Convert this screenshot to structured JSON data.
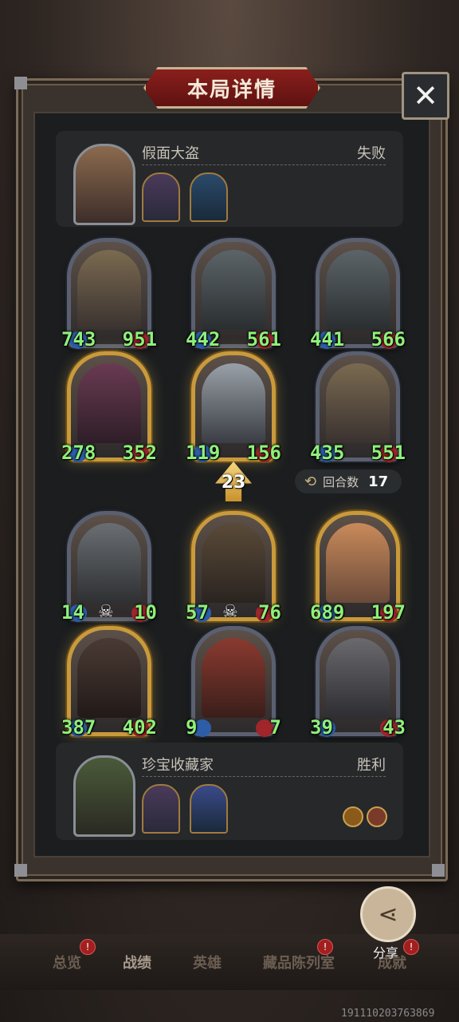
{
  "title": "本局详情",
  "close_icon": "close-icon",
  "top_player": {
    "name": "假面大盗",
    "result": "失败",
    "cards": [
      {
        "atk": "743",
        "hp": "951",
        "style": "silver",
        "art": "#7a6a50"
      },
      {
        "atk": "442",
        "hp": "561",
        "style": "silver",
        "art": "#5c6468"
      },
      {
        "atk": "441",
        "hp": "566",
        "style": "silver",
        "art": "#5c6468"
      },
      {
        "atk": "278",
        "hp": "352",
        "style": "gold",
        "art": "#6a3a52"
      },
      {
        "atk": "119",
        "hp": "156",
        "style": "gold",
        "art": "#7f858c"
      },
      {
        "atk": "435",
        "hp": "551",
        "style": "silver",
        "art": "#7a6a50"
      }
    ]
  },
  "tier_level": "23",
  "rounds": {
    "label": "回合数",
    "value": "17"
  },
  "bottom_player": {
    "name": "珍宝收藏家",
    "result": "胜利",
    "cards": [
      {
        "atk": "14",
        "hp": "10",
        "style": "silver",
        "art": "#6a6e72",
        "dead": true
      },
      {
        "atk": "57",
        "hp": "76",
        "style": "gold",
        "art": "#5a4a38",
        "dead": true
      },
      {
        "atk": "689",
        "hp": "197",
        "style": "gold",
        "art": "#c98a5a",
        "dead": false
      },
      {
        "atk": "387",
        "hp": "402",
        "style": "gold",
        "art": "#4a3a34",
        "dead": false
      },
      {
        "atk": "9",
        "hp": "7",
        "style": "silver",
        "art": "#8a3a30",
        "dead": false
      },
      {
        "atk": "39",
        "hp": "43",
        "style": "silver",
        "art": "#6a6a6e",
        "dead": false
      }
    ]
  },
  "share_label": "分享",
  "nav": {
    "overview": "总览",
    "record": "战绩",
    "hero": "英雄",
    "gallery": "藏品陈列室",
    "achievement": "成就"
  },
  "uid": "191110203763869"
}
